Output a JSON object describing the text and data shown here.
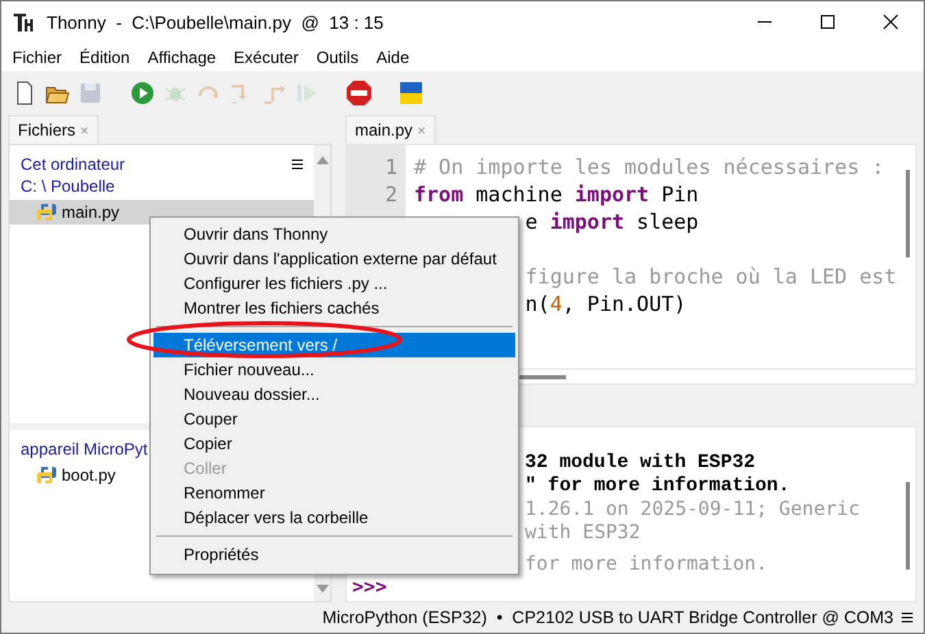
{
  "window": {
    "title": "Thonny  -  C:\\Poubelle\\main.py  @  13 : 15"
  },
  "menu_bar": [
    "Fichier",
    "Édition",
    "Affichage",
    "Exécuter",
    "Outils",
    "Aide"
  ],
  "toolbar": [
    {
      "kind": "new",
      "disabled": false
    },
    {
      "kind": "open",
      "disabled": false
    },
    {
      "kind": "save",
      "disabled": true
    },
    {
      "kind": "run",
      "disabled": false
    },
    {
      "kind": "debug",
      "disabled": true
    },
    {
      "kind": "step_over",
      "disabled": true
    },
    {
      "kind": "step_into",
      "disabled": true
    },
    {
      "kind": "step_out",
      "disabled": true
    },
    {
      "kind": "resume",
      "disabled": true
    },
    {
      "kind": "stop",
      "disabled": false
    },
    {
      "kind": "flag",
      "disabled": false
    }
  ],
  "files_panel": {
    "tab": "Fichiers",
    "tab_close": "×",
    "section_title": "Cet ordinateur",
    "path": "C: \\ Poubelle",
    "local_files": [
      {
        "name": "main.py",
        "selected": true
      }
    ],
    "device_title": "appareil MicroPyt",
    "device_files": [
      {
        "name": "boot.py",
        "selected": false
      }
    ]
  },
  "editor": {
    "tab": "main.py",
    "tab_close": "×",
    "lines": [
      {
        "number": "1",
        "kind": "full",
        "tokens": [
          {
            "t": "# On importe les modules nécessaires :",
            "kind": "comment"
          }
        ]
      },
      {
        "number": "2",
        "kind": "full",
        "tokens": [
          {
            "t": "from",
            "kind": "keyword"
          },
          {
            "t": " machine ",
            "kind": "plain"
          },
          {
            "t": "import",
            "kind": "keyword"
          },
          {
            "t": " Pin",
            "kind": "plain"
          }
        ]
      },
      {
        "kind": "partial",
        "tokens": [
          {
            "t": "e ",
            "kind": "plain"
          },
          {
            "t": "import",
            "kind": "keyword"
          },
          {
            "t": " sleep",
            "kind": "plain"
          }
        ]
      },
      {
        "kind": "blank"
      },
      {
        "kind": "partial",
        "tokens": [
          {
            "t": "figure la broche où la LED est",
            "kind": "comment"
          }
        ]
      },
      {
        "kind": "partial",
        "tokens": [
          {
            "t": "n(",
            "kind": "plain"
          },
          {
            "t": "4",
            "kind": "number"
          },
          {
            "t": ", Pin.OUT)",
            "kind": "plain"
          }
        ]
      }
    ]
  },
  "shell": {
    "lines": [
      {
        "kind": "banner",
        "text": "32 module with ESP32"
      },
      {
        "kind": "banner",
        "text": "\" for more information."
      },
      {
        "kind": "output",
        "text": "1.26.1 on 2025-09-11; Generic"
      },
      {
        "kind": "output",
        "text": "with ESP32"
      },
      {
        "kind": "blank"
      },
      {
        "kind": "output",
        "text": "for more information."
      },
      {
        "kind": "prompt",
        "text": ">>>"
      }
    ]
  },
  "context_menu": [
    {
      "kind": "item",
      "label": "Ouvrir dans Thonny",
      "selected": false,
      "disabled": false
    },
    {
      "kind": "item",
      "label": "Ouvrir dans l'application externe par défaut",
      "selected": false,
      "disabled": false
    },
    {
      "kind": "item",
      "label": "Configurer les fichiers .py ...",
      "selected": false,
      "disabled": false
    },
    {
      "kind": "item",
      "label": "Montrer les fichiers cachés",
      "selected": false,
      "disabled": false
    },
    {
      "kind": "separator"
    },
    {
      "kind": "item",
      "label": "Téléversement vers /",
      "selected": true,
      "disabled": false
    },
    {
      "kind": "item",
      "label": "Fichier nouveau...",
      "selected": false,
      "disabled": false
    },
    {
      "kind": "item",
      "label": "Nouveau dossier...",
      "selected": false,
      "disabled": false
    },
    {
      "kind": "item",
      "label": "Couper",
      "selected": false,
      "disabled": false
    },
    {
      "kind": "item",
      "label": "Copier",
      "selected": false,
      "disabled": false
    },
    {
      "kind": "item",
      "label": "Coller",
      "selected": false,
      "disabled": true
    },
    {
      "kind": "item",
      "label": "Renommer",
      "selected": false,
      "disabled": false
    },
    {
      "kind": "item",
      "label": "Déplacer vers la corbeille",
      "selected": false,
      "disabled": false
    },
    {
      "kind": "separator"
    },
    {
      "kind": "item",
      "label": "Propriétés",
      "selected": false,
      "disabled": false
    }
  ],
  "status_bar": {
    "text": "MicroPython (ESP32)  •  CP2102 USB to UART Bridge Controller @ COM3"
  }
}
